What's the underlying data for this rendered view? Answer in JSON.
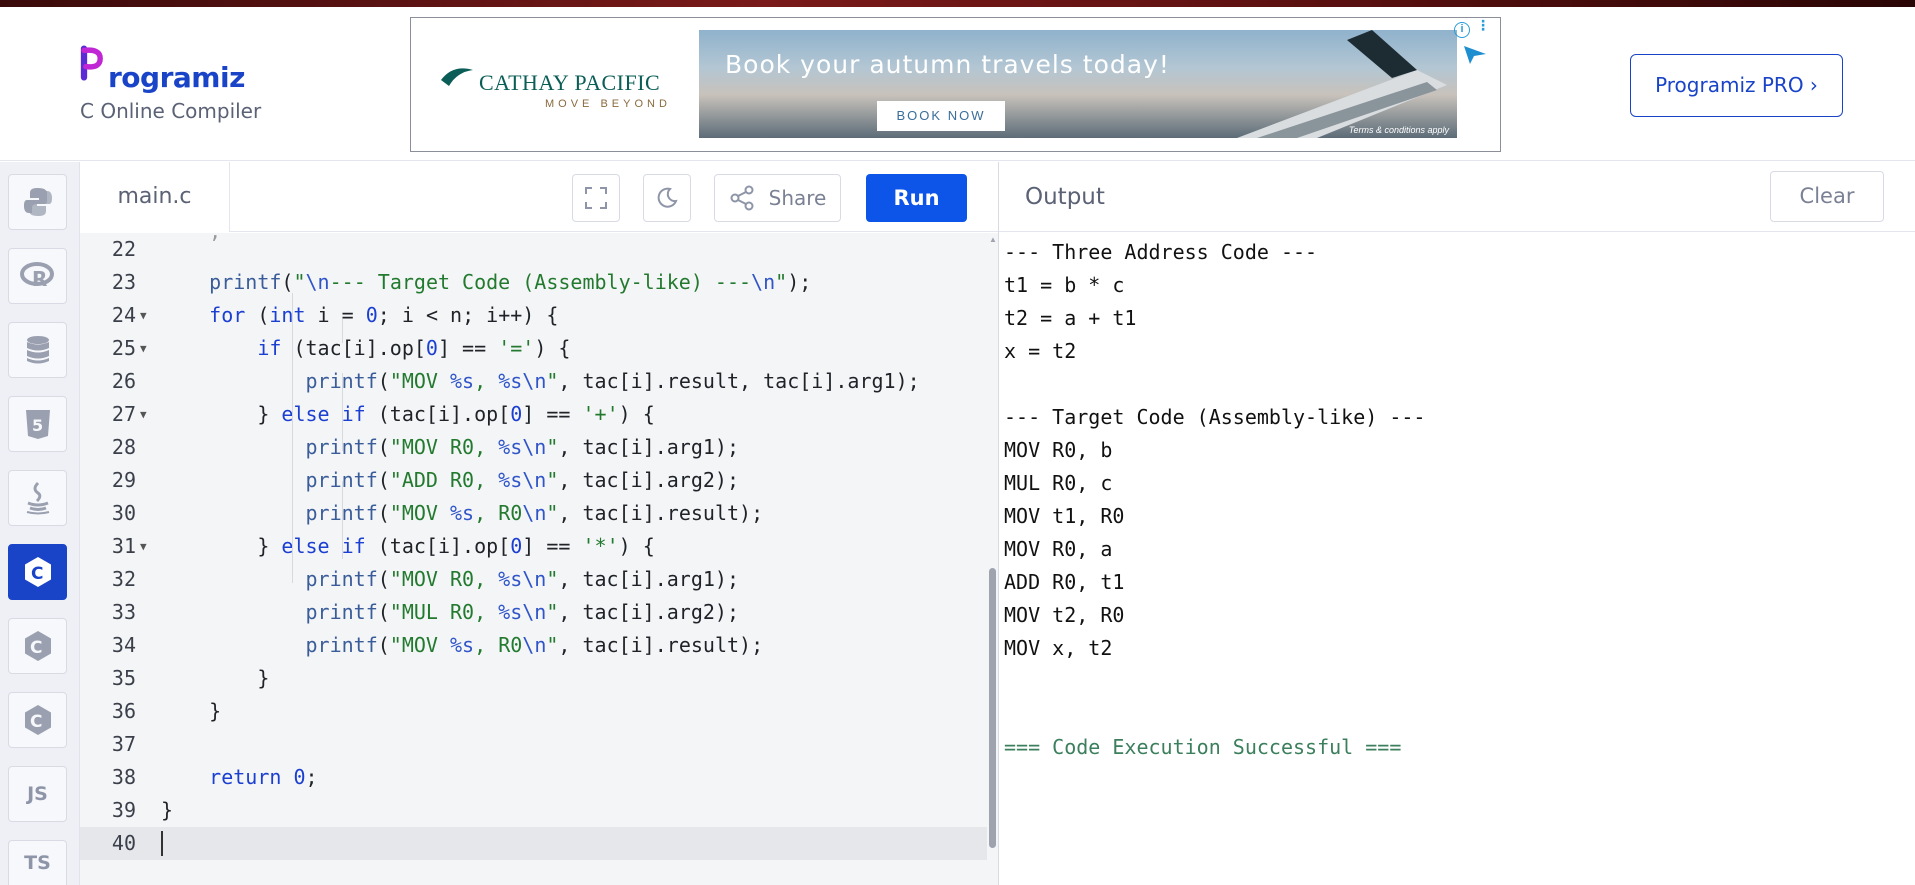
{
  "header": {
    "logo_text": "rogramiz",
    "subtitle": "C Online Compiler",
    "pro_button": "Programiz PRO ›"
  },
  "ad": {
    "brand": "CATHAY PACIFIC",
    "tagline": "MOVE BEYOND",
    "headline": "Book your autumn travels today!",
    "cta": "BOOK NOW",
    "terms": "Terms & conditions apply",
    "info_icon": "i"
  },
  "sidebar": {
    "items": [
      {
        "name": "python",
        "icon": "python-icon",
        "label": ""
      },
      {
        "name": "r",
        "icon": "r-icon",
        "label": "R"
      },
      {
        "name": "sql",
        "icon": "database-icon",
        "label": ""
      },
      {
        "name": "html",
        "icon": "html5-icon",
        "label": "5"
      },
      {
        "name": "java",
        "icon": "java-icon",
        "label": ""
      },
      {
        "name": "c",
        "icon": "c-icon",
        "label": "C",
        "active": true
      },
      {
        "name": "cpp",
        "icon": "cpp-icon",
        "label": "C"
      },
      {
        "name": "csharp",
        "icon": "csharp-icon",
        "label": "C"
      },
      {
        "name": "js",
        "icon": "js-icon",
        "label": "JS"
      },
      {
        "name": "ts",
        "icon": "ts-icon",
        "label": "TS"
      }
    ]
  },
  "editor": {
    "file_tab": "main.c",
    "share_label": "Share",
    "run_label": "Run",
    "lines": [
      {
        "n": "22",
        "fold": false,
        "html": ""
      },
      {
        "n": "23",
        "fold": false,
        "html": "    <span class='fn'>printf</span>(<span class='str'>\"</span><span class='esc'>\\n</span><span class='str'>--- Target Code (Assembly-like) ---</span><span class='esc'>\\n</span><span class='str'>\"</span>);"
      },
      {
        "n": "24",
        "fold": true,
        "html": "    <span class='kw'>for</span> (<span class='kw'>int</span> i = <span class='num'>0</span>; i &lt; n; i++) {"
      },
      {
        "n": "25",
        "fold": true,
        "html": "        <span class='kw'>if</span> (tac[i].op[<span class='num'>0</span>] == <span class='str'>'='</span>) {"
      },
      {
        "n": "26",
        "fold": false,
        "html": "            <span class='fn'>printf</span>(<span class='str'>\"MOV </span><span class='esc'>%s</span><span class='str'>, </span><span class='esc'>%s\\n</span><span class='str'>\"</span>, tac[i].result, tac[i].arg1);"
      },
      {
        "n": "27",
        "fold": true,
        "html": "        } <span class='kw'>else if</span> (tac[i].op[<span class='num'>0</span>] == <span class='str'>'+'</span>) {"
      },
      {
        "n": "28",
        "fold": false,
        "html": "            <span class='fn'>printf</span>(<span class='str'>\"MOV R0, </span><span class='esc'>%s\\n</span><span class='str'>\"</span>, tac[i].arg1);"
      },
      {
        "n": "29",
        "fold": false,
        "html": "            <span class='fn'>printf</span>(<span class='str'>\"ADD R0, </span><span class='esc'>%s\\n</span><span class='str'>\"</span>, tac[i].arg2);"
      },
      {
        "n": "30",
        "fold": false,
        "html": "            <span class='fn'>printf</span>(<span class='str'>\"MOV </span><span class='esc'>%s</span><span class='str'>, R0</span><span class='esc'>\\n</span><span class='str'>\"</span>, tac[i].result);"
      },
      {
        "n": "31",
        "fold": true,
        "html": "        } <span class='kw'>else if</span> (tac[i].op[<span class='num'>0</span>] == <span class='str'>'*'</span>) {"
      },
      {
        "n": "32",
        "fold": false,
        "html": "            <span class='fn'>printf</span>(<span class='str'>\"MOV R0, </span><span class='esc'>%s\\n</span><span class='str'>\"</span>, tac[i].arg1);"
      },
      {
        "n": "33",
        "fold": false,
        "html": "            <span class='fn'>printf</span>(<span class='str'>\"MUL R0, </span><span class='esc'>%s\\n</span><span class='str'>\"</span>, tac[i].arg2);"
      },
      {
        "n": "34",
        "fold": false,
        "html": "            <span class='fn'>printf</span>(<span class='str'>\"MOV </span><span class='esc'>%s</span><span class='str'>, R0</span><span class='esc'>\\n</span><span class='str'>\"</span>, tac[i].result);"
      },
      {
        "n": "35",
        "fold": false,
        "html": "        }"
      },
      {
        "n": "36",
        "fold": false,
        "html": "    }"
      },
      {
        "n": "37",
        "fold": false,
        "html": ""
      },
      {
        "n": "38",
        "fold": false,
        "html": "    <span class='kw'>return</span> <span class='num'>0</span>;"
      },
      {
        "n": "39",
        "fold": false,
        "html": "}"
      },
      {
        "n": "40",
        "fold": false,
        "html": "",
        "current": true
      }
    ]
  },
  "output": {
    "title": "Output",
    "clear_label": "Clear",
    "lines": [
      "--- Three Address Code ---",
      "t1 = b * c",
      "t2 = a + t1",
      "x = t2",
      "",
      "--- Target Code (Assembly-like) ---",
      "MOV R0, b",
      "MUL R0, c",
      "MOV t1, R0",
      "MOV R0, a",
      "ADD R0, t1",
      "MOV t2, R0",
      "MOV x, t2",
      "",
      "",
      "=== Code Execution Successful ==="
    ]
  }
}
